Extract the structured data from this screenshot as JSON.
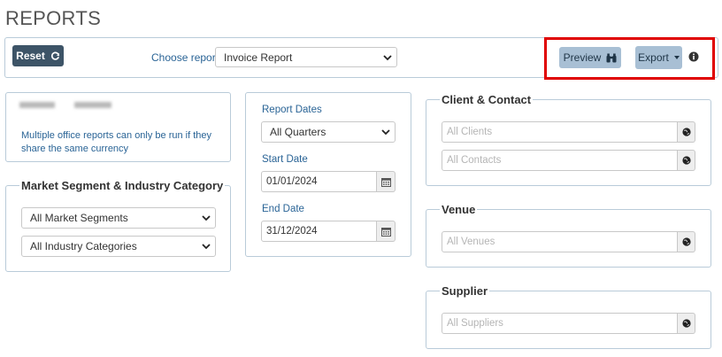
{
  "page": {
    "title": "REPORTS"
  },
  "toolbar": {
    "reset_label": "Reset",
    "choose_report_label": "Choose report",
    "report_selected": "Invoice Report",
    "preview_label": "Preview",
    "export_label": "Export"
  },
  "office": {
    "note": "Multiple office reports can only be run if they share the same currency"
  },
  "market": {
    "legend": "Market Segment & Industry Category",
    "segment_selected": "All Market Segments",
    "industry_selected": "All Industry Categories"
  },
  "dates": {
    "report_dates_label": "Report Dates",
    "report_dates_selected": "All Quarters",
    "start_label": "Start Date",
    "start_value": "01/01/2024",
    "end_label": "End Date",
    "end_value": "31/12/2024"
  },
  "client_contact": {
    "legend": "Client & Contact",
    "clients_placeholder": "All Clients",
    "contacts_placeholder": "All Contacts"
  },
  "venue": {
    "legend": "Venue",
    "venues_placeholder": "All Venues"
  },
  "supplier": {
    "legend": "Supplier",
    "suppliers_placeholder": "All Suppliers"
  },
  "colors": {
    "primary_button": "#3d5467",
    "secondary_button": "#a8bfd4",
    "link_text": "#2a6496",
    "panel_border": "#b9cbd9",
    "highlight": "#e00000"
  }
}
